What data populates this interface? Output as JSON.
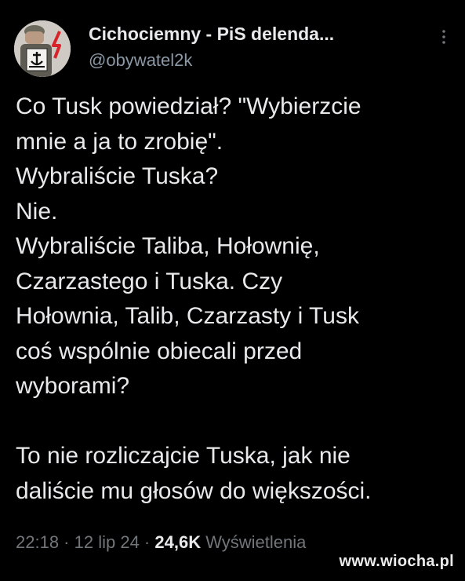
{
  "author": {
    "display_name": "Cichociemny - PiS delenda...",
    "handle": "@obywatel2k",
    "avatar_icon": "person-with-anchor-emblem-icon",
    "more_icon": "more-options-icon"
  },
  "tweet": {
    "text": "Co Tusk powiedział? \"Wybierzcie\nmnie a ja to zrobię\".\nWybraliście Tuska?\nNie.\nWybraliście Taliba, Hołownię,\nCzarzastego i Tuska. Czy\nHołownia, Talib, Czarzasty i Tusk\ncoś wspólnie obiecali przed\nwyborami?\n\nTo nie rozliczajcie Tuska, jak nie\ndaliście mu głosów do większości."
  },
  "meta": {
    "time": "22:18",
    "separator_1": " · ",
    "date": "12 lip 24",
    "separator_2": " · ",
    "views_count": "24,6K",
    "views_label": " Wyświetlenia"
  },
  "watermark": {
    "text": "www.wiocha.pl"
  },
  "colors": {
    "background": "#000000",
    "primary_text": "#e7e9ea",
    "secondary_text": "#8b98a5",
    "meta_text": "#71767b",
    "anchor_red": "#d8232a"
  }
}
